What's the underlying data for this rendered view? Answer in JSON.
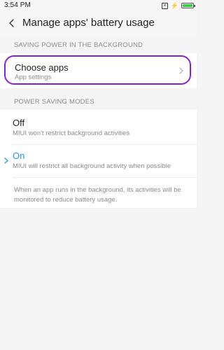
{
  "status_bar": {
    "time": "3:54 PM",
    "sim_icon": "sim-x-icon",
    "charge_icon": "lightning-icon",
    "battery_icon": "battery-icon",
    "battery_color": "#3ec83e"
  },
  "app_bar": {
    "back_icon": "back-arrow-icon",
    "title": "Manage apps' battery usage"
  },
  "sections": {
    "background": {
      "header": "SAVING POWER IN THE BACKGROUND",
      "item": {
        "title": "Choose apps",
        "subtitle": "App settings",
        "icon": "chevron-right-icon"
      }
    },
    "modes": {
      "header": "POWER SAVING MODES",
      "options": [
        {
          "title": "Off",
          "subtitle": "MIUI won't restrict background activities",
          "selected": false
        },
        {
          "title": "On",
          "subtitle": "MIUI will restrict all background activity when possible",
          "selected": true
        }
      ],
      "selected_icon": "checkmark-icon",
      "info": "When an app runs in the background, its activities will be monitored to reduce battery usage."
    }
  },
  "colors": {
    "accent": "#2196f3",
    "highlight_border": "#8a1fd6",
    "background": "#f5f5f5",
    "card": "#ffffff"
  }
}
